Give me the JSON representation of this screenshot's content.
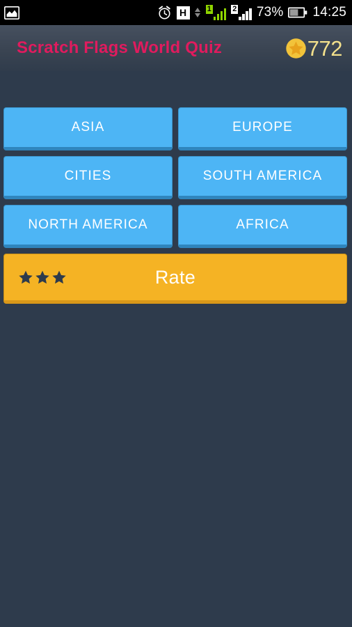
{
  "status_bar": {
    "left_icons": [
      {
        "name": "gallery-icon",
        "label": "Gallery"
      }
    ],
    "right_icons": [
      {
        "name": "alarm-clock-icon",
        "label": "Alarm"
      },
      {
        "name": "hspa-network-icon",
        "label": "H"
      },
      {
        "name": "data-transfer-arrows-icon",
        "label": "Data transfer"
      },
      {
        "name": "sim1-signal-icon",
        "label": "1"
      },
      {
        "name": "sim2-signal-icon",
        "label": "2"
      },
      {
        "name": "battery-icon",
        "label": "Battery"
      }
    ],
    "network_type": "H",
    "sim1_label": "1",
    "sim2_label": "2",
    "battery_percent": "73%",
    "clock": "14:25"
  },
  "header": {
    "title": "Scratch Flags World Quiz",
    "title_color": "#e01b5e",
    "score": "772",
    "score_color": "#f3e08c",
    "coin_icon": "gold-star-coin-icon"
  },
  "main": {
    "categories": [
      {
        "label": "ASIA"
      },
      {
        "label": "EUROPE"
      },
      {
        "label": "CITIES"
      },
      {
        "label": "SOUTH AMERICA"
      },
      {
        "label": "NORTH AMERICA"
      },
      {
        "label": "AFRICA"
      }
    ],
    "category_button_color": "#4db5f5",
    "rate": {
      "label": "Rate",
      "stars": 3,
      "button_color": "#f5b324",
      "star_color": "#2e3b4c"
    }
  },
  "theme": {
    "background": "#2e3b4c",
    "accent_pink": "#e01b5e",
    "accent_blue": "#4db5f5",
    "accent_amber": "#f5b324"
  }
}
